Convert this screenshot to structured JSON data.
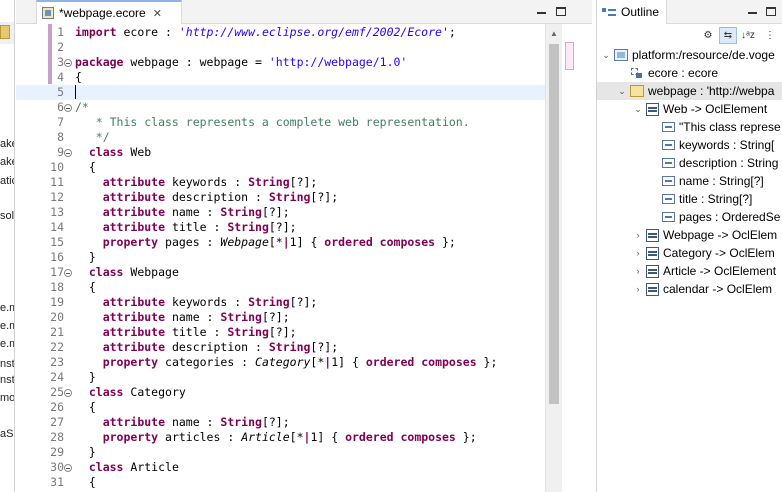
{
  "left_panel": {
    "fragments": [
      "ake",
      "ake",
      "atic",
      "solu",
      "e.m",
      "e.m",
      "e.m",
      "nst",
      "nst",
      "mo",
      "aSl"
    ]
  },
  "editor": {
    "tab_label": "*webpage.ecore",
    "tab_close": "✕",
    "lines": [
      {
        "n": "1",
        "fold": false,
        "segs": [
          [
            "kw",
            "import"
          ],
          [
            "pu",
            " ecore : "
          ],
          [
            "str",
            "'http://www.eclipse.org/emf/2002/Ecore'"
          ],
          [
            "pu",
            ";"
          ]
        ]
      },
      {
        "n": "2",
        "fold": false,
        "segs": []
      },
      {
        "n": "3",
        "fold": true,
        "segs": [
          [
            "kw",
            "package"
          ],
          [
            "pu",
            " webpage : webpage = "
          ],
          [
            "str2",
            "'http://webpage/1.0'"
          ]
        ]
      },
      {
        "n": "4",
        "fold": false,
        "segs": [
          [
            "pu",
            "{"
          ]
        ]
      },
      {
        "n": "5",
        "fold": false,
        "current": true,
        "segs": []
      },
      {
        "n": "6",
        "fold": true,
        "segs": [
          [
            "cmt",
            "/*"
          ]
        ]
      },
      {
        "n": "7",
        "fold": false,
        "segs": [
          [
            "cmt",
            "   * This class represents a complete web representation."
          ]
        ]
      },
      {
        "n": "8",
        "fold": false,
        "segs": [
          [
            "cmt",
            "   */"
          ]
        ]
      },
      {
        "n": "9",
        "fold": true,
        "segs": [
          [
            "pu",
            "  "
          ],
          [
            "kw",
            "class"
          ],
          [
            "pu",
            " Web"
          ]
        ]
      },
      {
        "n": "10",
        "fold": false,
        "segs": [
          [
            "pu",
            "  {"
          ]
        ]
      },
      {
        "n": "11",
        "fold": false,
        "segs": [
          [
            "pu",
            "    "
          ],
          [
            "kw",
            "attribute"
          ],
          [
            "pu",
            " keywords : "
          ],
          [
            "typ",
            "String"
          ],
          [
            "pu",
            "[?];"
          ]
        ]
      },
      {
        "n": "12",
        "fold": false,
        "segs": [
          [
            "pu",
            "    "
          ],
          [
            "kw",
            "attribute"
          ],
          [
            "pu",
            " description : "
          ],
          [
            "typ",
            "String"
          ],
          [
            "pu",
            "[?];"
          ]
        ]
      },
      {
        "n": "13",
        "fold": false,
        "segs": [
          [
            "pu",
            "    "
          ],
          [
            "kw",
            "attribute"
          ],
          [
            "pu",
            " name : "
          ],
          [
            "typ",
            "String"
          ],
          [
            "pu",
            "[?];"
          ]
        ]
      },
      {
        "n": "14",
        "fold": false,
        "segs": [
          [
            "pu",
            "    "
          ],
          [
            "kw",
            "attribute"
          ],
          [
            "pu",
            " title : "
          ],
          [
            "typ",
            "String"
          ],
          [
            "pu",
            "[?];"
          ]
        ]
      },
      {
        "n": "15",
        "fold": false,
        "segs": [
          [
            "pu",
            "    "
          ],
          [
            "kw",
            "property"
          ],
          [
            "pu",
            " pages : "
          ],
          [
            "it",
            "Webpage"
          ],
          [
            "pu",
            "[*"
          ],
          [
            "pipe",
            "|"
          ],
          [
            "pu",
            "1] { "
          ],
          [
            "kw",
            "ordered composes"
          ],
          [
            "pu",
            " };"
          ]
        ]
      },
      {
        "n": "16",
        "fold": false,
        "segs": [
          [
            "pu",
            "  }"
          ]
        ]
      },
      {
        "n": "17",
        "fold": true,
        "segs": [
          [
            "pu",
            "  "
          ],
          [
            "kw",
            "class"
          ],
          [
            "pu",
            " Webpage"
          ]
        ]
      },
      {
        "n": "18",
        "fold": false,
        "segs": [
          [
            "pu",
            "  {"
          ]
        ]
      },
      {
        "n": "19",
        "fold": false,
        "segs": [
          [
            "pu",
            "    "
          ],
          [
            "kw",
            "attribute"
          ],
          [
            "pu",
            " keywords : "
          ],
          [
            "typ",
            "String"
          ],
          [
            "pu",
            "[?];"
          ]
        ]
      },
      {
        "n": "20",
        "fold": false,
        "segs": [
          [
            "pu",
            "    "
          ],
          [
            "kw",
            "attribute"
          ],
          [
            "pu",
            " name : "
          ],
          [
            "typ",
            "String"
          ],
          [
            "pu",
            "[?];"
          ]
        ]
      },
      {
        "n": "21",
        "fold": false,
        "segs": [
          [
            "pu",
            "    "
          ],
          [
            "kw",
            "attribute"
          ],
          [
            "pu",
            " title : "
          ],
          [
            "typ",
            "String"
          ],
          [
            "pu",
            "[?];"
          ]
        ]
      },
      {
        "n": "22",
        "fold": false,
        "segs": [
          [
            "pu",
            "    "
          ],
          [
            "kw",
            "attribute"
          ],
          [
            "pu",
            " description : "
          ],
          [
            "typ",
            "String"
          ],
          [
            "pu",
            "[?];"
          ]
        ]
      },
      {
        "n": "23",
        "fold": false,
        "segs": [
          [
            "pu",
            "    "
          ],
          [
            "kw",
            "property"
          ],
          [
            "pu",
            " categories : "
          ],
          [
            "it",
            "Category"
          ],
          [
            "pu",
            "[*"
          ],
          [
            "pipe",
            "|"
          ],
          [
            "pu",
            "1] { "
          ],
          [
            "kw",
            "ordered composes"
          ],
          [
            "pu",
            " };"
          ]
        ]
      },
      {
        "n": "24",
        "fold": false,
        "segs": [
          [
            "pu",
            "  }"
          ]
        ]
      },
      {
        "n": "25",
        "fold": true,
        "segs": [
          [
            "pu",
            "  "
          ],
          [
            "kw",
            "class"
          ],
          [
            "pu",
            " Category"
          ]
        ]
      },
      {
        "n": "26",
        "fold": false,
        "segs": [
          [
            "pu",
            "  {"
          ]
        ]
      },
      {
        "n": "27",
        "fold": false,
        "segs": [
          [
            "pu",
            "    "
          ],
          [
            "kw",
            "attribute"
          ],
          [
            "pu",
            " name : "
          ],
          [
            "typ",
            "String"
          ],
          [
            "pu",
            "[?];"
          ]
        ]
      },
      {
        "n": "28",
        "fold": false,
        "segs": [
          [
            "pu",
            "    "
          ],
          [
            "kw",
            "property"
          ],
          [
            "pu",
            " articles : "
          ],
          [
            "it",
            "Article"
          ],
          [
            "pu",
            "[*"
          ],
          [
            "pipe",
            "|"
          ],
          [
            "pu",
            "1] { "
          ],
          [
            "kw",
            "ordered composes"
          ],
          [
            "pu",
            " };"
          ]
        ]
      },
      {
        "n": "29",
        "fold": false,
        "segs": [
          [
            "pu",
            "  }"
          ]
        ]
      },
      {
        "n": "30",
        "fold": true,
        "segs": [
          [
            "pu",
            "  "
          ],
          [
            "kw",
            "class"
          ],
          [
            "pu",
            " Article"
          ]
        ]
      },
      {
        "n": "31",
        "fold": false,
        "segs": [
          [
            "pu",
            "  {"
          ]
        ]
      }
    ]
  },
  "outline": {
    "tab_label": "Outline",
    "toolbar": [
      {
        "name": "hide-fields-button",
        "glyph": "⚙",
        "pressed": false
      },
      {
        "name": "link-with-editor-button",
        "glyph": "⇆",
        "pressed": true
      },
      {
        "name": "sort-button",
        "glyph": "↓ᵃz",
        "pressed": false
      },
      {
        "name": "view-menu-button",
        "glyph": "⋮",
        "pressed": false
      }
    ],
    "rows": [
      {
        "indent": 0,
        "twisty": "⌄",
        "icon": "res",
        "label": "platform:/resource/de.voge",
        "selected": false
      },
      {
        "indent": 1,
        "twisty": "",
        "icon": "import",
        "label": "ecore : ecore",
        "selected": false
      },
      {
        "indent": 1,
        "twisty": "⌄",
        "icon": "pkg",
        "label": "webpage : 'http://webpa",
        "selected": true
      },
      {
        "indent": 2,
        "twisty": "⌄",
        "icon": "cls",
        "label": "Web -> OclElement",
        "selected": false
      },
      {
        "indent": 3,
        "twisty": "",
        "icon": "attr",
        "label": "\"This class represe",
        "selected": false
      },
      {
        "indent": 3,
        "twisty": "",
        "icon": "attr",
        "label": "keywords : String[",
        "selected": false
      },
      {
        "indent": 3,
        "twisty": "",
        "icon": "attr",
        "label": "description : String",
        "selected": false
      },
      {
        "indent": 3,
        "twisty": "",
        "icon": "attr",
        "label": "name : String[?]",
        "selected": false
      },
      {
        "indent": 3,
        "twisty": "",
        "icon": "attr",
        "label": "title : String[?]",
        "selected": false
      },
      {
        "indent": 3,
        "twisty": "",
        "icon": "attr",
        "label": "pages : OrderedSe",
        "selected": false
      },
      {
        "indent": 2,
        "twisty": "›",
        "icon": "cls",
        "label": "Webpage -> OclElem",
        "selected": false
      },
      {
        "indent": 2,
        "twisty": "›",
        "icon": "cls",
        "label": "Category -> OclElem",
        "selected": false
      },
      {
        "indent": 2,
        "twisty": "›",
        "icon": "cls",
        "label": "Article -> OclElement",
        "selected": false
      },
      {
        "indent": 2,
        "twisty": "›",
        "icon": "cls",
        "label": "calendar -> OclElem",
        "selected": false
      }
    ]
  },
  "colors": {
    "keyword": "#7f0055",
    "string": "#2a00ff",
    "comment": "#3f7f5f",
    "current_line": "#e8f2fe",
    "selection": "#e6e6e6"
  }
}
